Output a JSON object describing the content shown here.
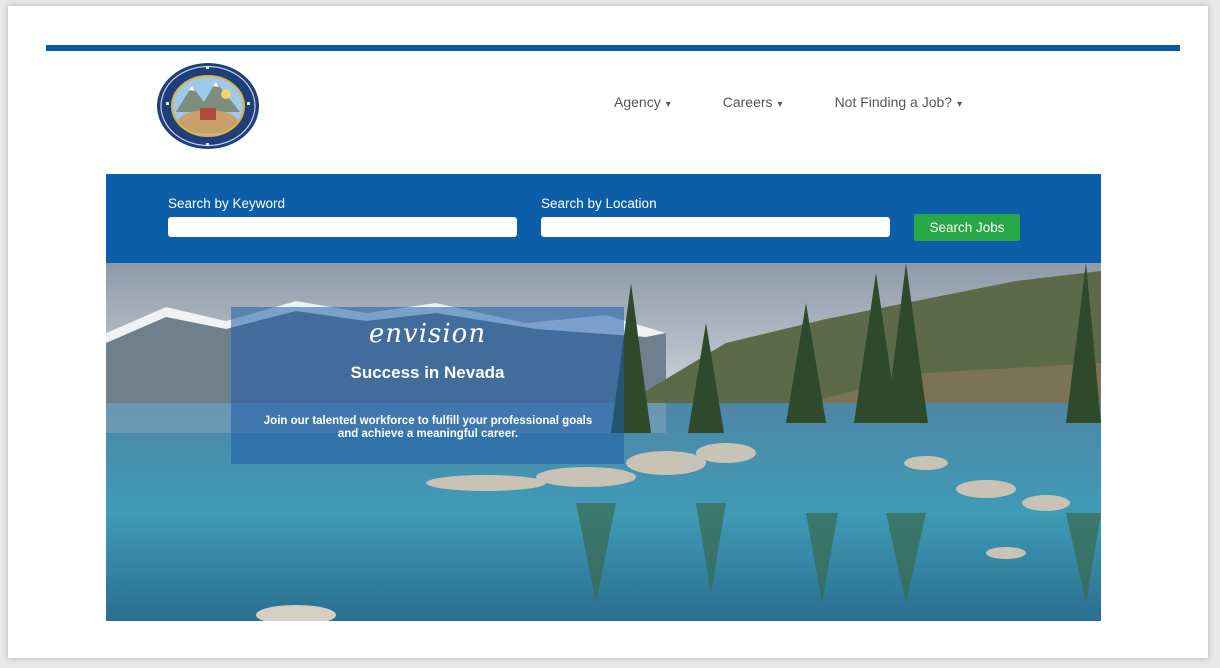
{
  "header": {
    "logo_icon": "state-seal-icon",
    "nav": [
      {
        "label": "Agency"
      },
      {
        "label": "Careers"
      },
      {
        "label": "Not Finding a Job?"
      }
    ]
  },
  "search": {
    "keyword_label": "Search by Keyword",
    "keyword_value": "",
    "location_label": "Search by Location",
    "location_value": "",
    "button_label": "Search Jobs"
  },
  "hero": {
    "script_word": "envision",
    "tagline": "Success in Nevada",
    "blurb": "Join our talented workforce to fulfill your professional goals and achieve a meaningful career."
  },
  "colors": {
    "brand_blue": "#0c5ea8",
    "button_green": "#27a745"
  }
}
